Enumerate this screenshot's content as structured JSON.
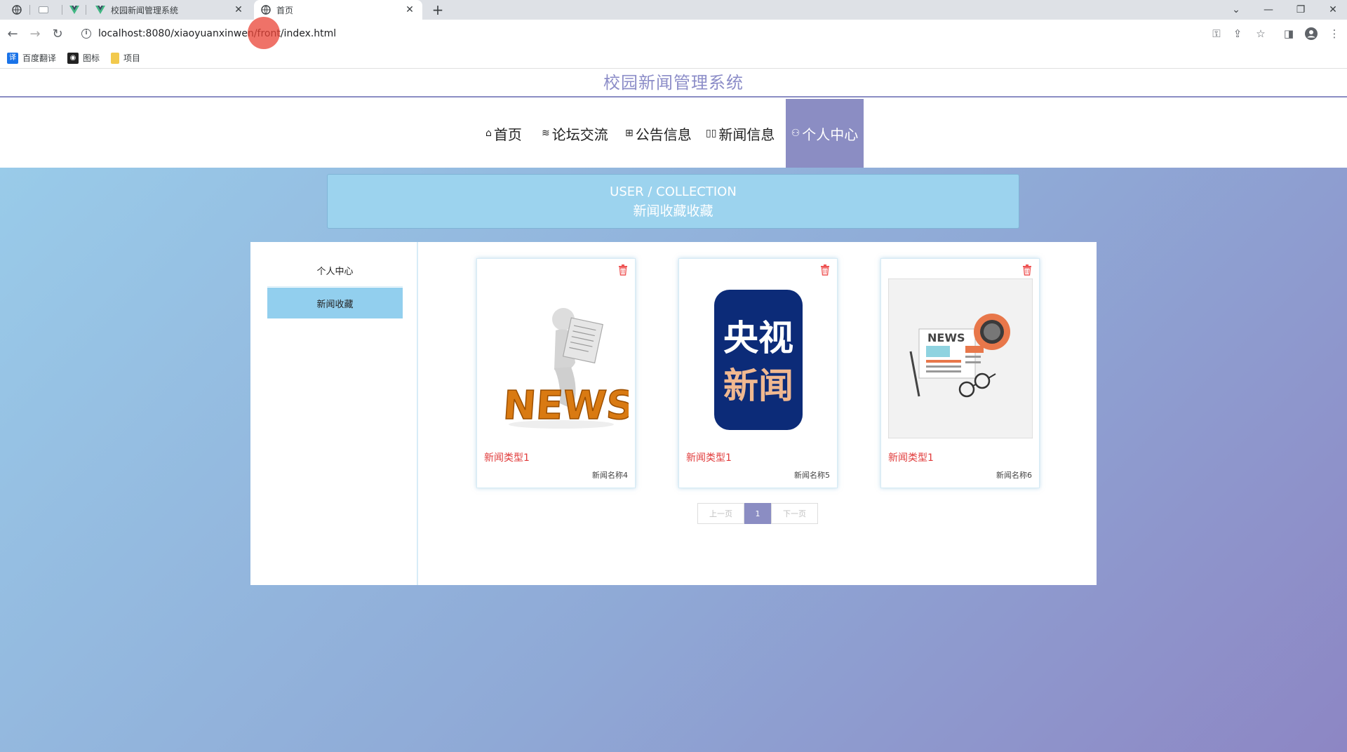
{
  "browser": {
    "tabs": [
      {
        "title": "校园新闻管理系统",
        "active": false
      },
      {
        "title": "首页",
        "active": true
      }
    ],
    "new_tab_label": "+",
    "url": "localhost:8080/xiaoyuanxinwen/front/index.html",
    "bookmarks": [
      {
        "label": "百度翻译",
        "icon": "translate-icon",
        "color": "#1a73e8"
      },
      {
        "label": "图标",
        "icon": "iconfont-icon",
        "color": "#222222"
      },
      {
        "label": "项目",
        "icon": "folder-icon",
        "color": "#f2c94c"
      }
    ]
  },
  "site": {
    "title": "校园新闻管理系统",
    "accent_color": "#8b8dc3",
    "nav": [
      {
        "label": "首页",
        "icon": "home-icon"
      },
      {
        "label": "论坛交流",
        "icon": "forum-icon"
      },
      {
        "label": "公告信息",
        "icon": "notice-icon"
      },
      {
        "label": "新闻信息",
        "icon": "news-icon"
      },
      {
        "label": "个人中心",
        "icon": "user-icon",
        "active": true
      }
    ]
  },
  "breadcrumb": {
    "en": "USER / COLLECTION",
    "cn": "新闻收藏收藏"
  },
  "sidebar": {
    "items": [
      {
        "label": "个人中心",
        "active": false
      },
      {
        "label": "新闻收藏",
        "active": true
      }
    ]
  },
  "collection": {
    "cards": [
      {
        "type": "新闻类型1",
        "name": "新闻名称4",
        "image": "news-figure-image"
      },
      {
        "type": "新闻类型1",
        "name": "新闻名称5",
        "image": "cctv-news-logo-image"
      },
      {
        "type": "新闻类型1",
        "name": "新闻名称6",
        "image": "news-paper-illustration-image"
      }
    ]
  },
  "pagination": {
    "prev_label": "上一页",
    "current_page": "1",
    "next_label": "下一页"
  }
}
